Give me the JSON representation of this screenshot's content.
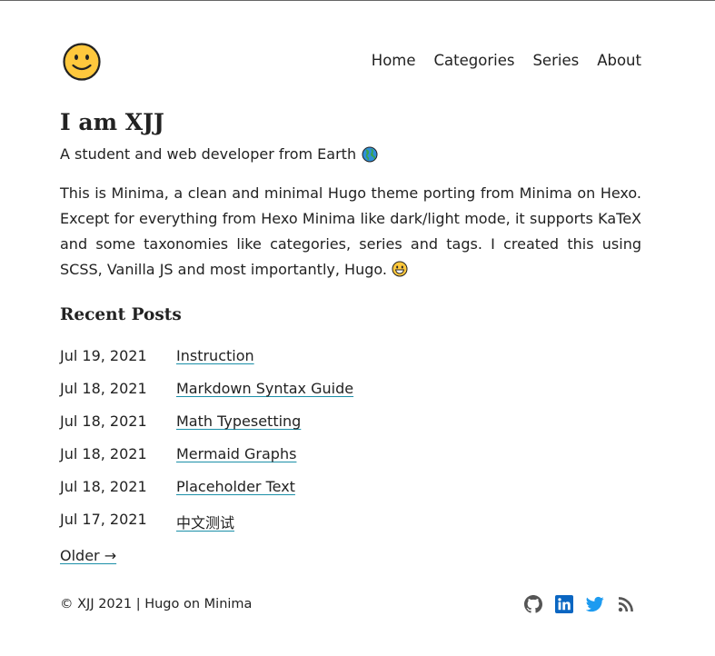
{
  "header": {
    "logo_icon": "smiley-face-icon",
    "nav": [
      {
        "label": "Home"
      },
      {
        "label": "Categories"
      },
      {
        "label": "Series"
      },
      {
        "label": "About"
      }
    ]
  },
  "profile": {
    "title": "I am XJJ",
    "subtitle": "A student and web developer from Earth",
    "subtitle_icon": "globe-icon",
    "intro": "This is Minima, a clean and minimal Hugo theme porting from Minima on Hexo. Except for everything from Hexo Minima like dark/light mode, it supports KaTeX and some taxonomies like categories, series and tags. I created this using SCSS, Vanilla JS and most importantly, Hugo.",
    "intro_icon": "grinning-face-icon"
  },
  "recent": {
    "title": "Recent Posts",
    "posts": [
      {
        "date": "Jul 19, 2021",
        "title": "Instruction"
      },
      {
        "date": "Jul 18, 2021",
        "title": "Markdown Syntax Guide"
      },
      {
        "date": "Jul 18, 2021",
        "title": "Math Typesetting"
      },
      {
        "date": "Jul 18, 2021",
        "title": "Mermaid Graphs"
      },
      {
        "date": "Jul 18, 2021",
        "title": "Placeholder Text"
      },
      {
        "date": "Jul 17, 2021",
        "title": "中文测试"
      }
    ],
    "older": "Older →"
  },
  "footer": {
    "copyright": "© XJJ 2021 | Hugo on Minima",
    "icons": [
      "github-icon",
      "linkedin-icon",
      "twitter-icon",
      "rss-icon"
    ]
  },
  "colors": {
    "text": "#222222",
    "link_underline": "#1b8fa8",
    "linkedin": "#0a66c2",
    "twitter": "#1d9bf0",
    "icon_gray": "#555555"
  }
}
